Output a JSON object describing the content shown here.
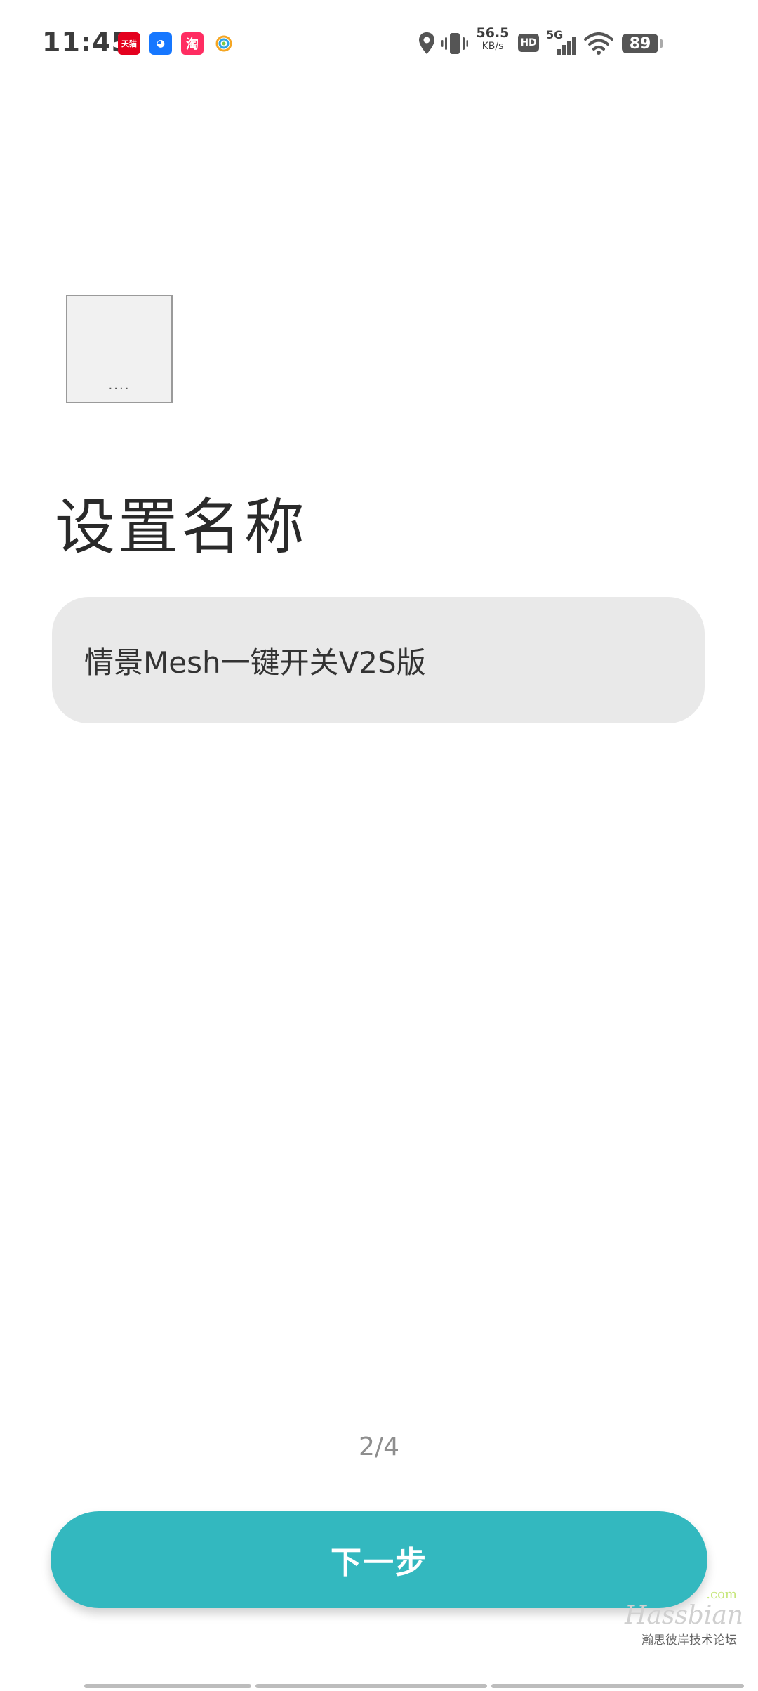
{
  "status_bar": {
    "time": "11:45",
    "notification_apps": [
      {
        "name": "tmall-icon",
        "glyph": "天猫"
      },
      {
        "name": "robot-app-icon",
        "glyph": "◕"
      },
      {
        "name": "taobao-icon",
        "glyph": "淘"
      },
      {
        "name": "colorful-ring-icon",
        "glyph": "◎"
      }
    ],
    "net_speed_value": "56.5",
    "net_speed_unit": "KB/s",
    "hd_label": "HD",
    "network_type": "5G",
    "battery_level": "89"
  },
  "device": {
    "image_dots": "...."
  },
  "page": {
    "title": "设置名称"
  },
  "name_field": {
    "value": "情景Mesh一键开关V2S版"
  },
  "step_indicator": "2/4",
  "next_button_label": "下一步",
  "watermark": {
    "com": ".com",
    "name": "Hassbian",
    "subtitle": "瀚思彼岸技术论坛"
  },
  "colors": {
    "accent": "#33b8bf",
    "field_bg": "#e9e9e9",
    "title": "#2a2a2a"
  }
}
